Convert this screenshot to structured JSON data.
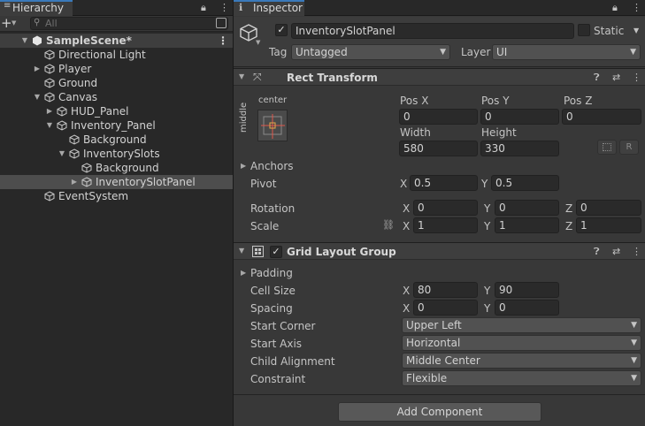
{
  "hierarchy": {
    "tab_label": "Hierarchy",
    "add_label": "+",
    "search_placeholder": "All",
    "rows": [
      {
        "label": "SampleScene*",
        "indent": 0,
        "expanded": true,
        "scene": true
      },
      {
        "label": "Directional Light",
        "indent": 1,
        "expanded": null
      },
      {
        "label": "Player",
        "indent": 1,
        "expanded": false
      },
      {
        "label": "Ground",
        "indent": 1,
        "expanded": null
      },
      {
        "label": "Canvas",
        "indent": 1,
        "expanded": true
      },
      {
        "label": "HUD_Panel",
        "indent": 2,
        "expanded": false
      },
      {
        "label": "Inventory_Panel",
        "indent": 2,
        "expanded": true
      },
      {
        "label": "Background",
        "indent": 3,
        "expanded": null
      },
      {
        "label": "InventorySlots",
        "indent": 3,
        "expanded": true
      },
      {
        "label": "Background",
        "indent": 4,
        "expanded": null
      },
      {
        "label": "InventorySlotPanel",
        "indent": 4,
        "expanded": false,
        "selected": true
      },
      {
        "label": "EventSystem",
        "indent": 1,
        "expanded": null
      }
    ]
  },
  "inspector": {
    "tab_label": "Inspector",
    "object_name": "InventorySlotPanel",
    "active_check": "✓",
    "static_label": "Static",
    "tag_label": "Tag",
    "tag_value": "Untagged",
    "layer_label": "Layer",
    "layer_value": "UI"
  },
  "rect_transform": {
    "title": "Rect Transform",
    "anchor_h": "center",
    "anchor_v": "middle",
    "pos_x_label": "Pos X",
    "pos_x": "0",
    "pos_y_label": "Pos Y",
    "pos_y": "0",
    "pos_z_label": "Pos Z",
    "pos_z": "0",
    "width_label": "Width",
    "width": "580",
    "height_label": "Height",
    "height": "330",
    "r_button": "R",
    "anchors_label": "Anchors",
    "pivot_label": "Pivot",
    "pivot_x": "0.5",
    "pivot_y": "0.5",
    "rotation_label": "Rotation",
    "rot_x": "0",
    "rot_y": "0",
    "rot_z": "0",
    "scale_label": "Scale",
    "scale_x": "1",
    "scale_y": "1",
    "scale_z": "1",
    "x": "X",
    "y": "Y",
    "z": "Z"
  },
  "grid_layout": {
    "title": "Grid Layout Group",
    "enabled_check": "✓",
    "padding_label": "Padding",
    "cell_size_label": "Cell Size",
    "cell_x": "80",
    "cell_y": "90",
    "spacing_label": "Spacing",
    "spacing_x": "0",
    "spacing_y": "0",
    "start_corner_label": "Start Corner",
    "start_corner": "Upper Left",
    "start_axis_label": "Start Axis",
    "start_axis": "Horizontal",
    "child_alignment_label": "Child Alignment",
    "child_alignment": "Middle Center",
    "constraint_label": "Constraint",
    "constraint": "Flexible"
  },
  "add_component_label": "Add Component",
  "colors": {
    "accent": "#3a79bb",
    "panel_bg": "#383838",
    "hierarchy_bg": "#282828",
    "selection": "#4d4d4d",
    "anchor_red": "#e0554a"
  }
}
